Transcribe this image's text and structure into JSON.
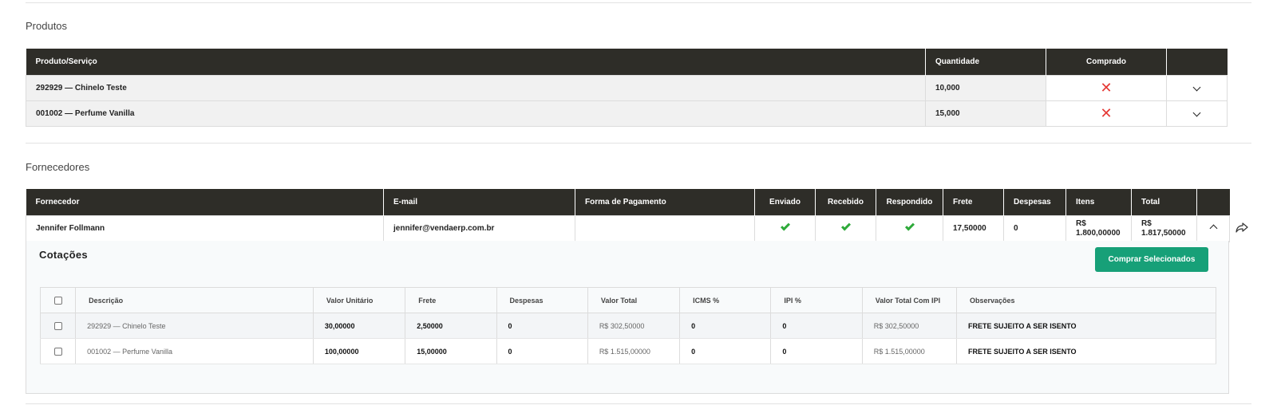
{
  "produtos": {
    "title": "Produtos",
    "headers": [
      "Produto/Serviço",
      "Quantidade",
      "Comprado",
      ""
    ],
    "rows": [
      {
        "produto": "292929 — Chinelo Teste",
        "quantidade": "10,000",
        "comprado": "✕"
      },
      {
        "produto": "001002 — Perfume Vanilla",
        "quantidade": "15,000",
        "comprado": "✕"
      }
    ]
  },
  "fornecedores": {
    "title": "Fornecedores",
    "headers": [
      "Fornecedor",
      "E-mail",
      "Forma de Pagamento",
      "Enviado",
      "Recebido",
      "Respondido",
      "Frete",
      "Despesas",
      "Itens",
      "Total",
      ""
    ],
    "rows": [
      {
        "fornecedor": "Jennifer Follmann",
        "email": "jennifer@vendaerp.com.br",
        "forma_pagamento": "",
        "frete": "17,50000",
        "despesas": "0",
        "itens_line1": "R$",
        "itens_line2": "1.800,00000",
        "total_line1": "R$",
        "total_line2": "1.817,50000"
      }
    ]
  },
  "cotacoes": {
    "title": "Cotações",
    "buy_button": "Comprar Selecionados",
    "headers": [
      "Descrição",
      "Valor Unitário",
      "Frete",
      "Despesas",
      "Valor Total",
      "ICMS %",
      "IPI %",
      "Valor Total Com IPI",
      "Observações"
    ],
    "rows": [
      {
        "descricao": "292929 — Chinelo Teste",
        "valor_unitario": "30,00000",
        "frete": "2,50000",
        "despesas": "0",
        "valor_total": "R$ 302,50000",
        "icms": "0",
        "ipi": "0",
        "valor_total_ipi": "R$ 302,50000",
        "observacoes": "FRETE SUJEITO A SER ISENTO"
      },
      {
        "descricao": "001002 — Perfume Vanilla",
        "valor_unitario": "100,00000",
        "frete": "15,00000",
        "despesas": "0",
        "valor_total": "R$ 1.515,00000",
        "icms": "0",
        "ipi": "0",
        "valor_total_ipi": "R$ 1.515,00000",
        "observacoes": "FRETE SUJEITO A SER ISENTO"
      }
    ]
  },
  "colors": {
    "header_bg": "#2e2d28",
    "accent_green": "#17a078",
    "check_green": "#2eaa3a",
    "cross_red": "#e53935"
  },
  "icons": [
    "cross-icon",
    "chevron-down-icon",
    "chevron-up-icon",
    "check-icon",
    "share-icon",
    "checkbox"
  ]
}
